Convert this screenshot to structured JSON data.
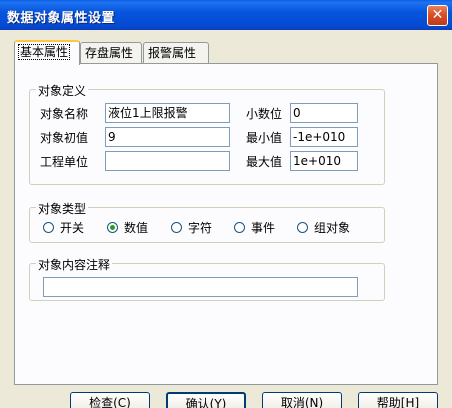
{
  "window": {
    "title": "数据对象属性设置",
    "close_glyph": "✕"
  },
  "tabs": [
    {
      "label": "基本属性",
      "active": true
    },
    {
      "label": "存盘属性",
      "active": false
    },
    {
      "label": "报警属性",
      "active": false
    }
  ],
  "object_def": {
    "legend": "对象定义",
    "name_label": "对象名称",
    "name_value": "液位1上限报警",
    "init_label": "对象初值",
    "init_value": "9",
    "unit_label": "工程单位",
    "unit_value": "",
    "decimals_label": "小数位",
    "decimals_value": "0",
    "min_label": "最小值",
    "min_value": "-1e+010",
    "max_label": "最大值",
    "max_value": "1e+010"
  },
  "object_type": {
    "legend": "对象类型",
    "options": [
      {
        "label": "开关",
        "selected": false
      },
      {
        "label": "数值",
        "selected": true
      },
      {
        "label": "字符",
        "selected": false
      },
      {
        "label": "事件",
        "selected": false
      },
      {
        "label": "组对象",
        "selected": false
      }
    ]
  },
  "comment": {
    "legend": "对象内容注释",
    "value": ""
  },
  "buttons": {
    "check": "检查(C)",
    "confirm": "确认(Y)",
    "cancel": "取消(N)",
    "help": "帮助[H]"
  }
}
